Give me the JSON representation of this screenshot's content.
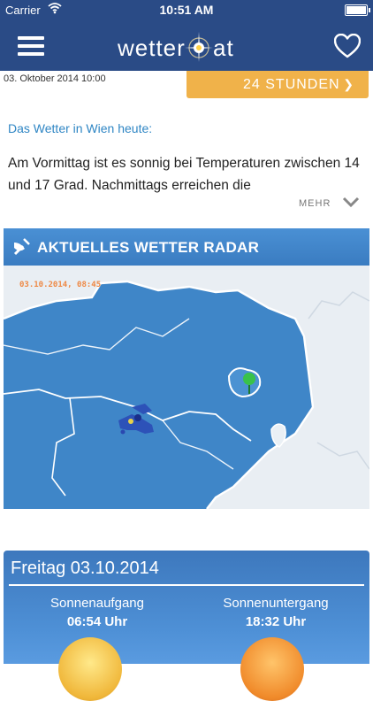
{
  "status": {
    "carrier": "Carrier",
    "time": "10:51 AM"
  },
  "nav": {
    "logo_left": "wetter",
    "logo_right": "at"
  },
  "date_line": "03. Oktober 2014 10:00",
  "button_24h": "24 STUNDEN",
  "weather_heading": "Das Wetter in Wien heute:",
  "weather_text": "Am Vormittag ist es sonnig bei Temperaturen zwischen 14 und 17 Grad. Nachmittags erreichen die",
  "more_label": "MEHR",
  "radar": {
    "title": "AKTUELLES WETTER RADAR",
    "timestamp": "03.10.2014, 08:45"
  },
  "forecast": {
    "date": "Freitag 03.10.2014",
    "sunrise_label": "Sonnenaufgang",
    "sunrise_time": "06:54 Uhr",
    "sunset_label": "Sonnenuntergang",
    "sunset_time": "18:32 Uhr"
  },
  "colors": {
    "nav": "#2a4b86",
    "accent_orange": "#f0b24a",
    "heading_blue": "#2f86c4",
    "radar_header": "#3a7cc1"
  }
}
